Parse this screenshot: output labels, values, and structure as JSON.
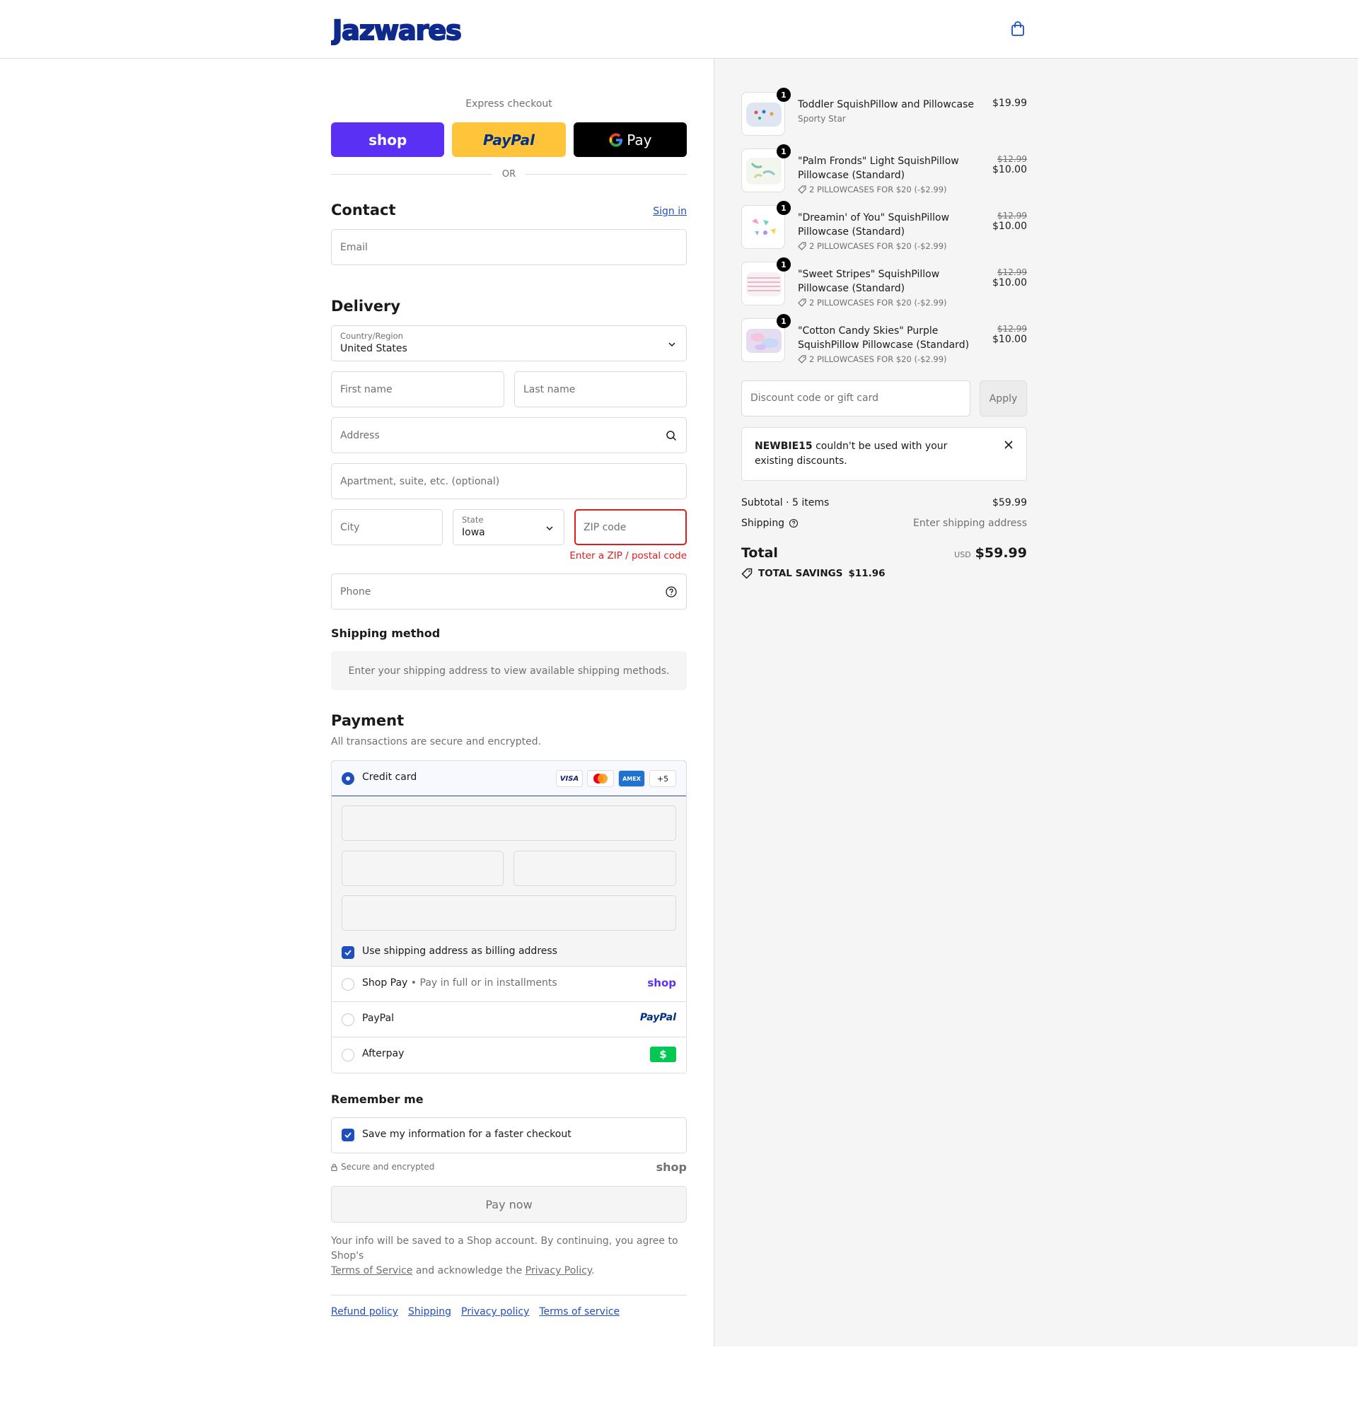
{
  "header": {
    "logo_text": "Jazwares",
    "cart_icon": "shopping-bag-icon"
  },
  "express": {
    "title": "Express checkout",
    "shop_label": "shop",
    "paypal_label": "PayPal",
    "gpay_label": "Pay",
    "or": "OR"
  },
  "contact": {
    "heading": "Contact",
    "signin": "Sign in",
    "email_placeholder": "Email"
  },
  "delivery": {
    "heading": "Delivery",
    "country_label": "Country/Region",
    "country_value": "United States",
    "first_name": "First name",
    "last_name": "Last name",
    "address": "Address",
    "apartment": "Apartment, suite, etc. (optional)",
    "city": "City",
    "state_label": "State",
    "state_value": "Iowa",
    "zip": "ZIP code",
    "zip_error": "Enter a ZIP / postal code",
    "phone": "Phone"
  },
  "shipping_method": {
    "heading": "Shipping method",
    "message": "Enter your shipping address to view available shipping methods."
  },
  "payment": {
    "heading": "Payment",
    "subtitle": "All transactions are secure and encrypted.",
    "credit_card": "Credit card",
    "card_logos": [
      "VISA",
      "AMEX",
      "+5"
    ],
    "billing_same": "Use shipping address as billing address",
    "shop_pay": "Shop Pay",
    "shop_pay_sub": "Pay in full or in installments",
    "shop_logo": "shop",
    "paypal": "PayPal",
    "paypal_logo": "PayPal",
    "afterpay": "Afterpay"
  },
  "remember": {
    "heading": "Remember me",
    "save_info": "Save my information for a faster checkout",
    "secure": "Secure and encrypted",
    "shop_logo": "shop"
  },
  "pay_now": "Pay now",
  "legal": {
    "text1": "Your info will be saved to a Shop account. By continuing, you agree to Shop's",
    "tos": "Terms of Service",
    "text2": "and acknowledge the",
    "privacy": "Privacy Policy",
    "period": "."
  },
  "footer": {
    "links": [
      "Refund policy",
      "Shipping",
      "Privacy policy",
      "Terms of service"
    ]
  },
  "cart": {
    "items": [
      {
        "qty": "1",
        "name": "Toddler SquishPillow and Pillowcase",
        "variant": "Sporty Star",
        "price": "$19.99",
        "old_price": "",
        "discount": ""
      },
      {
        "qty": "1",
        "name": "\"Palm Fronds\" Light SquishPillow Pillowcase (Standard)",
        "variant": "",
        "price": "$10.00",
        "old_price": "$12.99",
        "discount": "2 PILLOWCASES FOR $20 (-$2.99)"
      },
      {
        "qty": "1",
        "name": "\"Dreamin' of You\" SquishPillow Pillowcase (Standard)",
        "variant": "",
        "price": "$10.00",
        "old_price": "$12.99",
        "discount": "2 PILLOWCASES FOR $20 (-$2.99)"
      },
      {
        "qty": "1",
        "name": "\"Sweet Stripes\" SquishPillow Pillowcase (Standard)",
        "variant": "",
        "price": "$10.00",
        "old_price": "$12.99",
        "discount": "2 PILLOWCASES FOR $20 (-$2.99)"
      },
      {
        "qty": "1",
        "name": "\"Cotton Candy Skies\" Purple SquishPillow Pillowcase (Standard)",
        "variant": "",
        "price": "$10.00",
        "old_price": "$12.99",
        "discount": "2 PILLOWCASES FOR $20 (-$2.99)"
      }
    ],
    "discount_placeholder": "Discount code or gift card",
    "apply": "Apply",
    "notice_code": "NEWBIE15",
    "notice_text": "couldn't be used with your existing discounts.",
    "subtotal_label": "Subtotal · 5 items",
    "subtotal": "$59.99",
    "shipping_label": "Shipping",
    "shipping_value": "Enter shipping address",
    "total_label": "Total",
    "currency": "USD",
    "total": "$59.99",
    "savings_label": "TOTAL SAVINGS",
    "savings": "$11.96"
  },
  "colors": {
    "accent": "#1f4fbf",
    "shop_purple": "#5a31f4",
    "paypal_yellow": "#ffc439",
    "error": "#dd1d1d"
  }
}
